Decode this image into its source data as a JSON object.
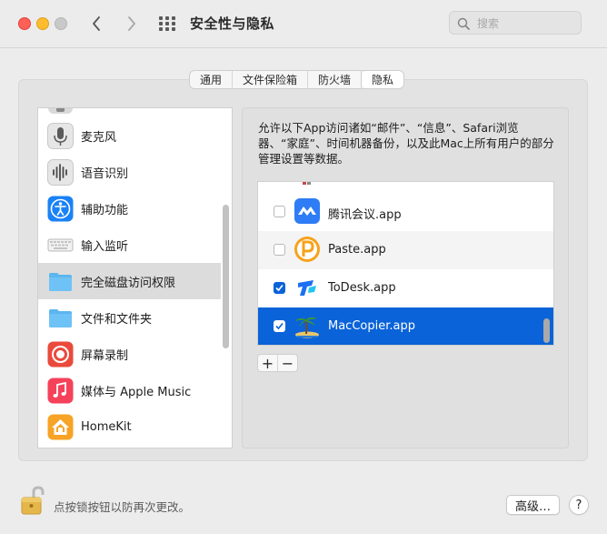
{
  "window": {
    "title": "安全性与隐私",
    "traffic_lights": [
      "close",
      "minimize",
      "zoom"
    ]
  },
  "toolbar": {
    "back_icon": "chevron-left-icon",
    "forward_icon": "chevron-right-icon",
    "grid_icon": "grid-icon"
  },
  "search": {
    "placeholder": "搜索",
    "value": ""
  },
  "tabs": [
    {
      "label": "通用",
      "active": false
    },
    {
      "label": "文件保险箱",
      "active": false
    },
    {
      "label": "防火墙",
      "active": false
    },
    {
      "label": "隐私",
      "active": true
    }
  ],
  "sidebar": {
    "items": [
      {
        "label": "麦克风",
        "icon": "microphone-icon",
        "selected": false
      },
      {
        "label": "语音识别",
        "icon": "waveform-icon",
        "selected": false
      },
      {
        "label": "辅助功能",
        "icon": "accessibility-icon",
        "selected": false
      },
      {
        "label": "输入监听",
        "icon": "keyboard-icon",
        "selected": false
      },
      {
        "label": "完全磁盘访问权限",
        "icon": "folder-icon",
        "selected": true
      },
      {
        "label": "文件和文件夹",
        "icon": "folder-icon",
        "selected": false
      },
      {
        "label": "屏幕录制",
        "icon": "screen-record-icon",
        "selected": false
      },
      {
        "label": "媒体与 Apple Music",
        "icon": "music-icon",
        "selected": false
      },
      {
        "label": "HomeKit",
        "icon": "home-icon",
        "selected": false
      }
    ]
  },
  "main": {
    "description": "允许以下App访问诸如“邮件”、“信息”、Safari浏览器、“家庭”、时间机器备份，以及此Mac上所有用户的部分管理设置等数据。",
    "apps": [
      {
        "label": "腾讯会议.app",
        "checked": false,
        "selected": false,
        "icon": "tencent-meeting-icon"
      },
      {
        "label": "Paste.app",
        "checked": false,
        "selected": false,
        "icon": "paste-icon"
      },
      {
        "label": "ToDesk.app",
        "checked": true,
        "selected": false,
        "icon": "todesk-icon"
      },
      {
        "label": "MacCopier.app",
        "checked": true,
        "selected": true,
        "icon": "maccopier-icon"
      }
    ],
    "add_label": "+",
    "remove_label": "−"
  },
  "footer": {
    "lock_text": "点按锁按钮以防再次更改。",
    "advanced_label": "高级…",
    "help_label": "?"
  },
  "colors": {
    "accent": "#0a63d8",
    "selected_sidebar": "#dcdcdc",
    "window_bg": "#ececec"
  }
}
